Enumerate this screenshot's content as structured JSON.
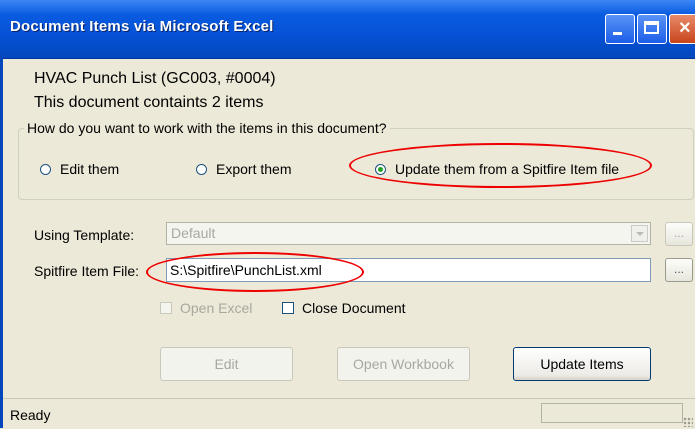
{
  "window": {
    "title": "Document Items via Microsoft Excel"
  },
  "info": {
    "document_name": "HVAC Punch List (GC003, #0004)",
    "item_count_text": "This document containts 2 items"
  },
  "group": {
    "legend": "How do you want to work with the items in this document?",
    "options": [
      {
        "label": "Edit them",
        "selected": false
      },
      {
        "label": "Export them",
        "selected": false
      },
      {
        "label": "Update them from a Spitfire Item file",
        "selected": true
      }
    ]
  },
  "template": {
    "label": "Using Template:",
    "value": "Default",
    "browse": "..."
  },
  "item_file": {
    "label": "Spitfire Item File:",
    "value": "S:\\Spitfire\\PunchList.xml",
    "browse": "..."
  },
  "checks": {
    "open_excel": {
      "label": "Open Excel",
      "checked": false,
      "enabled": false
    },
    "close_document": {
      "label": "Close Document",
      "checked": false,
      "enabled": true
    }
  },
  "buttons": {
    "edit": "Edit",
    "open_workbook": "Open Workbook",
    "update_items": "Update Items"
  },
  "status": {
    "text": "Ready"
  },
  "colors": {
    "title_bar": "#0552d6",
    "highlight": "#e00000",
    "dialog_bg": "#ece9d8"
  }
}
